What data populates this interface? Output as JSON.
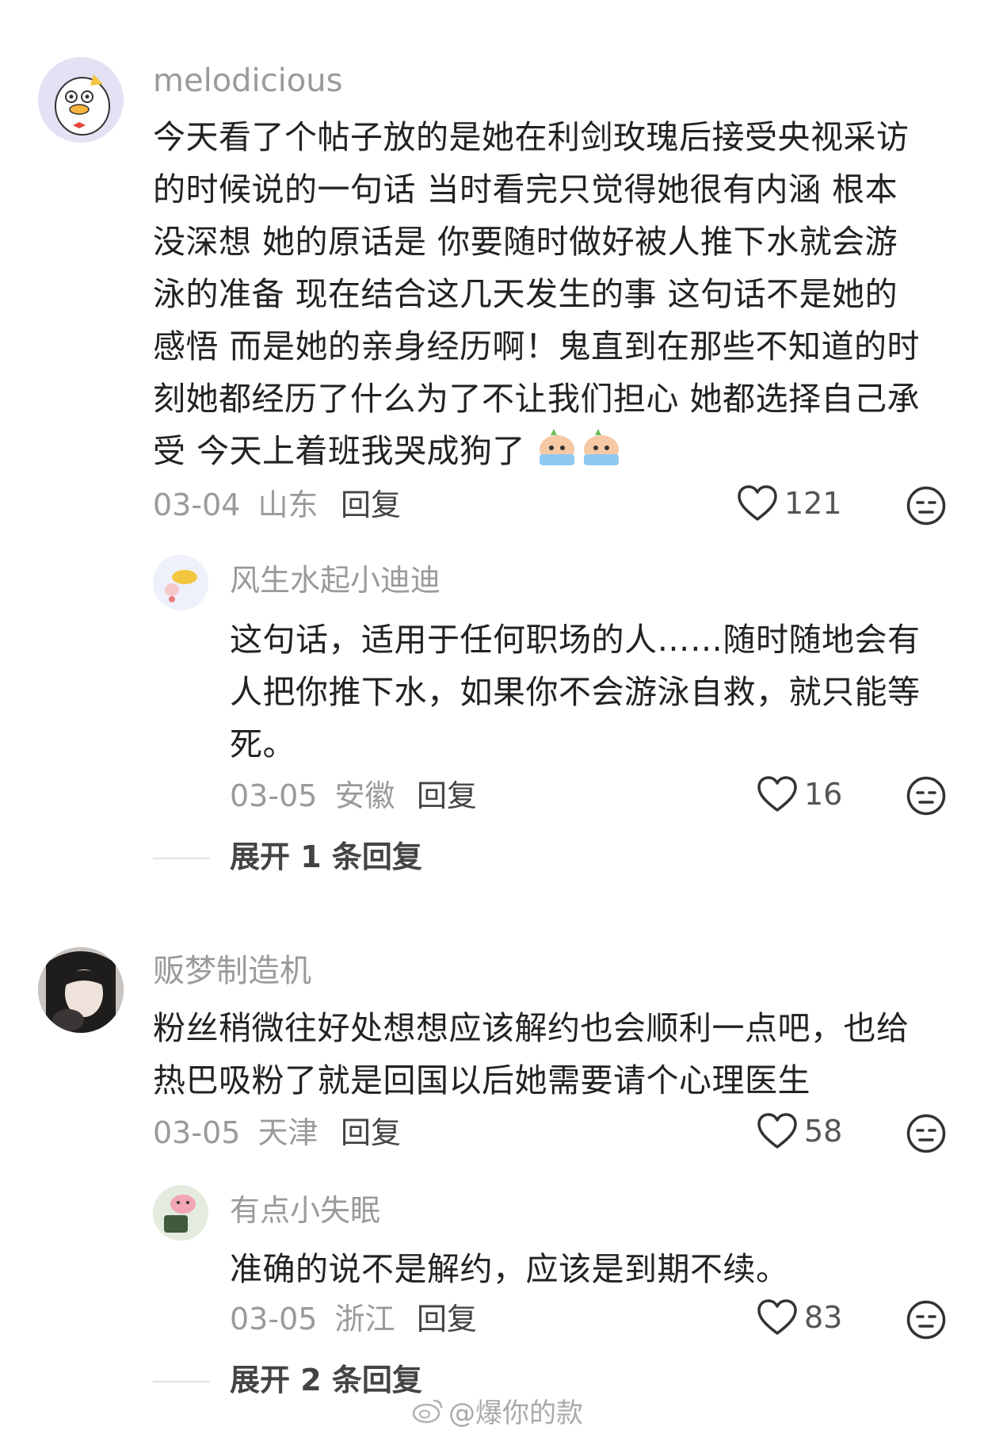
{
  "comments": [
    {
      "username": "melodicious",
      "text": "今天看了个帖子放的是她在利剑玫瑰后接受央视采访的时候说的一句话 当时看完只觉得她很有内涵 根本没深想 她的原话是 你要随时做好被人推下水就会游泳的准备 现在结合这几天发生的事 这句话不是她的感悟 而是她的亲身经历啊！鬼直到在那些不知道的时刻她都经历了什么为了不让我们担心 她都选择自己承受 今天上着班我哭成狗了",
      "lines": [
        "今天看了个帖子放的是她在利剑玫瑰后接受央视采访",
        "的时候说的一句话 当时看完只觉得她很有内涵 根本",
        "没深想 她的原话是 你要随时做好被人推下水就会游",
        "泳的准备 现在结合这几天发生的事 这句话不是她的",
        "感悟 而是她的亲身经历啊！鬼直到在那些不知道的时",
        "刻她都经历了什么为了不让我们担心 她都选择自己承",
        "受 今天上着班我哭成狗了"
      ],
      "date": "03-04",
      "location": "山东",
      "reply_label": "回复",
      "likes": "121",
      "emoji_icon": "crying-emoji-icon",
      "replies": [
        {
          "username": "风生水起小迪迪",
          "lines": [
            "这句话，适用于任何职场的人……随时随地会有",
            "人把你推下水，如果你不会游泳自救，就只能等",
            "死。"
          ],
          "date": "03-05",
          "location": "安徽",
          "reply_label": "回复",
          "likes": "16"
        }
      ],
      "expand_label": "展开 1 条回复"
    },
    {
      "username": "贩梦制造机",
      "lines": [
        "粉丝稍微往好处想想应该解约也会顺利一点吧，也给",
        "热巴吸粉了就是回国以后她需要请个心理医生"
      ],
      "date": "03-05",
      "location": "天津",
      "reply_label": "回复",
      "likes": "58",
      "replies": [
        {
          "username": "有点小失眠",
          "lines": [
            "准确的说不是解约，应该是到期不续。"
          ],
          "date": "03-05",
          "location": "浙江",
          "reply_label": "回复",
          "likes": "83"
        }
      ],
      "expand_label": "展开 2 条回复"
    }
  ],
  "watermark": "@爆你的款",
  "colors": {
    "username": "#9a9a9a",
    "text": "#222222",
    "meta": "#9a9a9a"
  },
  "icons": {
    "like": "heart-outline-icon",
    "dislike": "meh-face-icon",
    "watermark": "weibo-logo-icon"
  }
}
